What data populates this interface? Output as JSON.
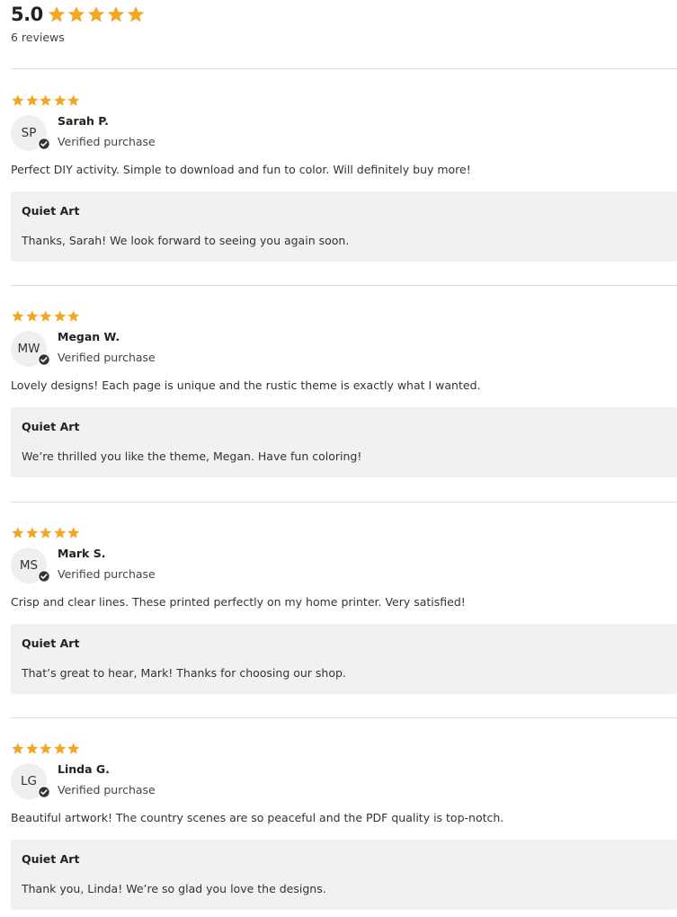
{
  "summary": {
    "rating": "5.0",
    "stars": 5,
    "count_label": "6 reviews"
  },
  "colors": {
    "star": "#f5a623",
    "badge": "#333333",
    "divider": "#dddddd",
    "reply_bg": "#f1f1f1"
  },
  "icons": {
    "star": "star-icon",
    "verified": "verified-check-icon"
  },
  "reviews": [
    {
      "stars": 5,
      "initials": "SP",
      "name": "Sarah P.",
      "verified": "Verified purchase",
      "text": "Perfect DIY activity. Simple to download and fun to color. Will definitely buy more!",
      "reply_author": "Quiet Art",
      "reply_text": "Thanks, Sarah! We look forward to seeing you again soon."
    },
    {
      "stars": 5,
      "initials": "MW",
      "name": "Megan W.",
      "verified": "Verified purchase",
      "text": "Lovely designs! Each page is unique and the rustic theme is exactly what I wanted.",
      "reply_author": "Quiet Art",
      "reply_text": "We’re thrilled you like the theme, Megan. Have fun coloring!"
    },
    {
      "stars": 5,
      "initials": "MS",
      "name": "Mark S.",
      "verified": "Verified purchase",
      "text": "Crisp and clear lines. These printed perfectly on my home printer. Very satisfied!",
      "reply_author": "Quiet Art",
      "reply_text": "That’s great to hear, Mark! Thanks for choosing our shop."
    },
    {
      "stars": 5,
      "initials": "LG",
      "name": "Linda G.",
      "verified": "Verified purchase",
      "text": "Beautiful artwork! The country scenes are so peaceful and the PDF quality is top-notch.",
      "reply_author": "Quiet Art",
      "reply_text": "Thank you, Linda! We’re so glad you love the designs."
    }
  ]
}
